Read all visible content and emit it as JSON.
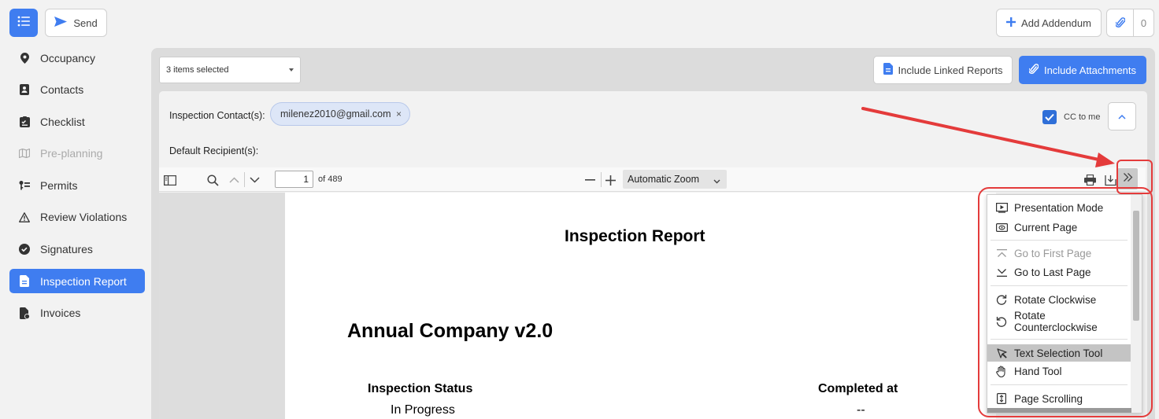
{
  "topbar": {
    "send_label": "Send",
    "add_addendum_label": "Add Addendum",
    "attachment_count": "0"
  },
  "sidebar": {
    "items": [
      {
        "label": "Occupancy",
        "icon": "map-pin-icon",
        "state": "normal"
      },
      {
        "label": "Contacts",
        "icon": "contact-card-icon",
        "state": "normal"
      },
      {
        "label": "Checklist",
        "icon": "checklist-icon",
        "state": "normal"
      },
      {
        "label": "Pre-planning",
        "icon": "map-icon",
        "state": "disabled"
      },
      {
        "label": "Permits",
        "icon": "permits-icon",
        "state": "normal"
      },
      {
        "label": "Review Violations",
        "icon": "warning-icon",
        "state": "normal"
      },
      {
        "label": "Signatures",
        "icon": "check-circle-icon",
        "state": "normal"
      },
      {
        "label": "Inspection Report",
        "icon": "report-icon",
        "state": "active"
      },
      {
        "label": "Invoices",
        "icon": "invoice-icon",
        "state": "normal"
      }
    ]
  },
  "main": {
    "select_value": "3 items selected",
    "linked_reports_label": "Include Linked Reports",
    "attachments_label": "Include Attachments",
    "contact_label": "Inspection Contact(s):",
    "contact_chip": "milenez2010@gmail.com",
    "chip_remove": "×",
    "cc_label": "CC to me",
    "default_recipients_label": "Default Recipient(s):"
  },
  "pdf_toolbar": {
    "page_value": "1",
    "page_of": "of 489",
    "zoom_value": "Automatic Zoom"
  },
  "pdf_doc": {
    "title": "Inspection Report",
    "subtitle": "Annual Company v2.0",
    "status_heading": "Inspection Status",
    "status_value": "In Progress",
    "completed_heading": "Completed at",
    "completed_value": "--"
  },
  "tools_menu": {
    "items": [
      {
        "label": "Presentation Mode",
        "icon": "presentation-icon"
      },
      {
        "label": "Current Page",
        "icon": "current-page-icon"
      },
      {
        "label": "Go to First Page",
        "icon": "first-page-icon"
      },
      {
        "label": "Go to Last Page",
        "icon": "last-page-icon"
      },
      {
        "label": "Rotate Clockwise",
        "icon": "rotate-cw-icon"
      },
      {
        "label": "Rotate Counterclockwise",
        "icon": "rotate-ccw-icon"
      },
      {
        "label": "Text Selection Tool",
        "icon": "cursor-icon"
      },
      {
        "label": "Hand Tool",
        "icon": "hand-icon"
      },
      {
        "label": "Page Scrolling",
        "icon": "page-scroll-icon"
      }
    ]
  },
  "colors": {
    "accent": "#3f7df0",
    "annotation": "#e43b3b"
  }
}
